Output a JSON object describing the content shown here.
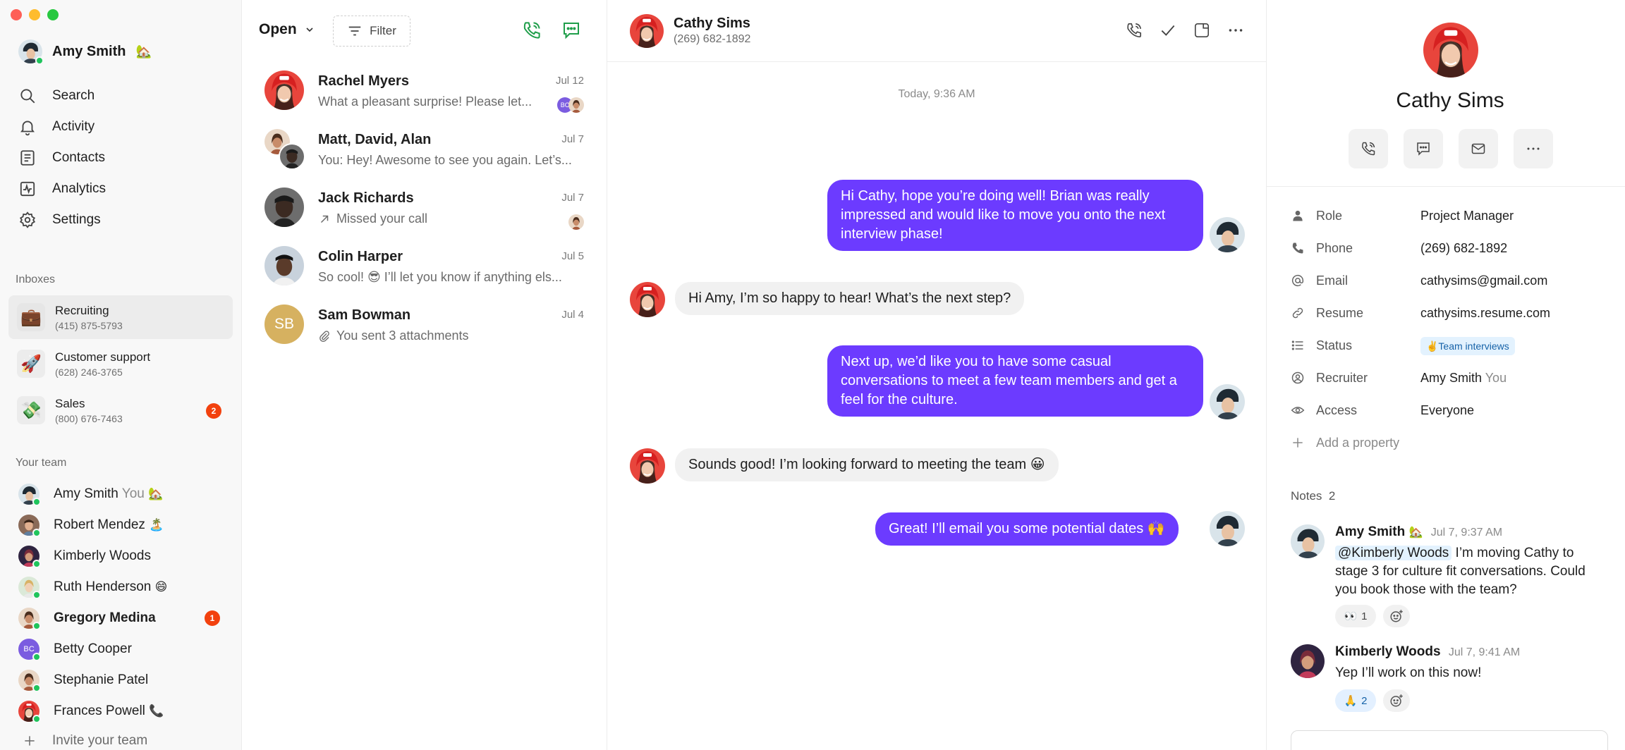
{
  "sidebar": {
    "user": {
      "name": "Amy Smith",
      "emoji": "🏡"
    },
    "nav": [
      {
        "label": "Search",
        "icon": "search-icon"
      },
      {
        "label": "Activity",
        "icon": "bell-icon"
      },
      {
        "label": "Contacts",
        "icon": "contacts-icon"
      },
      {
        "label": "Analytics",
        "icon": "analytics-icon"
      },
      {
        "label": "Settings",
        "icon": "gear-icon"
      }
    ],
    "inboxes_label": "Inboxes",
    "inboxes": [
      {
        "name": "Recruiting",
        "number": "(415) 875-5793",
        "emoji": "💼"
      },
      {
        "name": "Customer support",
        "number": "(628) 246-3765",
        "emoji": "🚀"
      },
      {
        "name": "Sales",
        "number": "(800) 676-7463",
        "emoji": "💸",
        "badge": "2"
      }
    ],
    "team_label": "Your team",
    "team": [
      {
        "name": "Amy Smith",
        "you": "You",
        "emoji": "🏡"
      },
      {
        "name": "Robert Mendez",
        "emoji": "🏝️"
      },
      {
        "name": "Kimberly Woods"
      },
      {
        "name": "Ruth Henderson",
        "emoji": "😄"
      },
      {
        "name": "Gregory Medina",
        "badge": "1"
      },
      {
        "name": "Betty Cooper",
        "initials": "BC"
      },
      {
        "name": "Stephanie Patel"
      },
      {
        "name": "Frances Powell",
        "emoji": "📞"
      }
    ],
    "invite_label": "Invite your team"
  },
  "list": {
    "filter_state": "Open",
    "filter_label": "Filter",
    "conversations": [
      {
        "name": "Rachel Myers",
        "date": "Jul 12",
        "preview": "What a pleasant surprise! Please let..."
      },
      {
        "name": "Matt, David, Alan",
        "date": "Jul 7",
        "preview": "You: Hey! Awesome to see you again. Let’s..."
      },
      {
        "name": "Jack Richards",
        "date": "Jul 7",
        "preview": "Missed your call"
      },
      {
        "name": "Colin Harper",
        "date": "Jul 5",
        "preview": "So cool! 😎 I’ll let you know if anything els..."
      },
      {
        "name": "Sam Bowman",
        "date": "Jul 4",
        "preview": "You sent 3 attachments",
        "initials": "SB"
      }
    ],
    "mini_initials": "BC"
  },
  "chat": {
    "contact_name": "Cathy Sims",
    "contact_phone": "(269) 682-1892",
    "day_label": "Today, 9:36 AM",
    "messages": [
      {
        "dir": "out",
        "text": "Hi Cathy, hope you’re doing well! Brian was really impressed and would like to move you onto the next interview phase!"
      },
      {
        "dir": "in",
        "text": "Hi Amy, I’m so happy to hear! What’s the next step?"
      },
      {
        "dir": "out",
        "text": "Next up, we’d like you to have some casual conversations to meet a few team members and get a feel for the culture."
      },
      {
        "dir": "in",
        "text": "Sounds good! I’m looking forward to meeting the team 😀"
      },
      {
        "dir": "out",
        "text": "Great! I’ll email you some potential dates 🙌"
      }
    ]
  },
  "profile": {
    "name": "Cathy Sims",
    "properties": [
      {
        "key": "Role",
        "value": "Project Manager",
        "icon": "person-icon"
      },
      {
        "key": "Phone",
        "value": "(269) 682-1892",
        "icon": "phone-icon"
      },
      {
        "key": "Email",
        "value": "cathysims@gmail.com",
        "icon": "at-icon"
      },
      {
        "key": "Resume",
        "value": "cathysims.resume.com",
        "icon": "link-icon"
      },
      {
        "key": "Status",
        "value": "✌️Team interviews",
        "icon": "list-icon"
      },
      {
        "key": "Recruiter",
        "value": "Amy Smith",
        "value_suffix": "You",
        "icon": "user-circle-icon"
      },
      {
        "key": "Access",
        "value": "Everyone",
        "icon": "eye-icon"
      }
    ],
    "add_property": "Add a property",
    "notes_label": "Notes",
    "notes_count": "2",
    "notes": [
      {
        "author": "Amy Smith",
        "emoji": "🏡",
        "time": "Jul 7, 9:37 AM",
        "mention": "@Kimberly Woods",
        "text": " I’m moving Cathy to stage 3 for culture fit conversations. Could you book those with the team?",
        "reaction": "👀",
        "reaction_count": "1"
      },
      {
        "author": "Kimberly Woods",
        "time": "Jul 7, 9:41 AM",
        "text": "Yep I’ll work on this now!",
        "reaction": "🙏",
        "reaction_count": "2"
      }
    ]
  },
  "colors": {
    "accent": "#6c3bff",
    "online": "#1fc45c",
    "badge": "#f2410e",
    "call_green": "#1f9e4a"
  }
}
